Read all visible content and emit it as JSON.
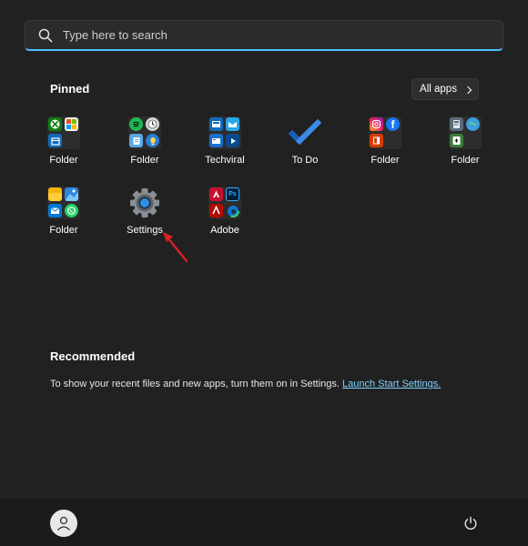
{
  "search": {
    "placeholder": "Type here to search"
  },
  "pinned": {
    "title": "Pinned",
    "all_apps_label": "All apps",
    "apps": [
      {
        "label": "Folder",
        "icon": "xbox-folder-icon"
      },
      {
        "label": "Folder",
        "icon": "spotify-folder-icon"
      },
      {
        "label": "Techviral",
        "icon": "techviral-icon"
      },
      {
        "label": "To Do",
        "icon": "todo-checkmark-icon"
      },
      {
        "label": "Folder",
        "icon": "social-folder-icon"
      },
      {
        "label": "Folder",
        "icon": "tools-folder-icon"
      },
      {
        "label": "Folder",
        "icon": "photos-folder-icon"
      },
      {
        "label": "Settings",
        "icon": "gear-icon"
      },
      {
        "label": "Adobe",
        "icon": "adobe-folder-icon"
      }
    ]
  },
  "recommended": {
    "title": "Recommended",
    "text": "To show your recent files and new apps, turn them on in Settings.",
    "link": "Launch Start Settings."
  },
  "bottom": {
    "user_icon": "user-avatar-icon",
    "power_icon": "power-icon"
  },
  "colors": {
    "background": "#212121",
    "accent": "#4cc2ff",
    "link": "#7fd2ff",
    "annotation_arrow": "#e02020"
  }
}
